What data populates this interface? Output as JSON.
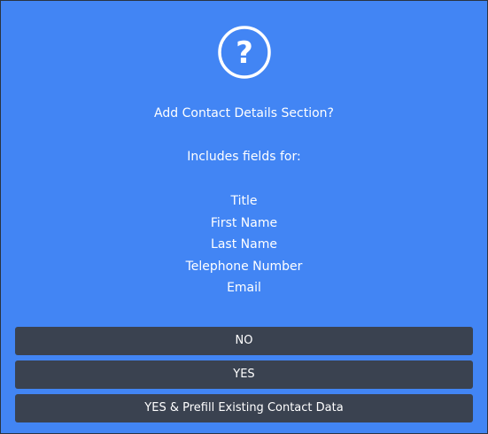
{
  "dialog": {
    "icon": "question-circle-icon",
    "icon_glyph": "?",
    "title": "Add Contact Details Section?",
    "subtitle": "Includes fields for:",
    "fields": [
      "Title",
      "First Name",
      "Last Name",
      "Telephone Number",
      "Email"
    ],
    "buttons": {
      "no": "NO",
      "yes": "YES",
      "prefill": "YES & Prefill Existing Contact Data"
    }
  },
  "colors": {
    "background": "#4285f4",
    "button": "#3a4250",
    "text": "#ffffff"
  }
}
